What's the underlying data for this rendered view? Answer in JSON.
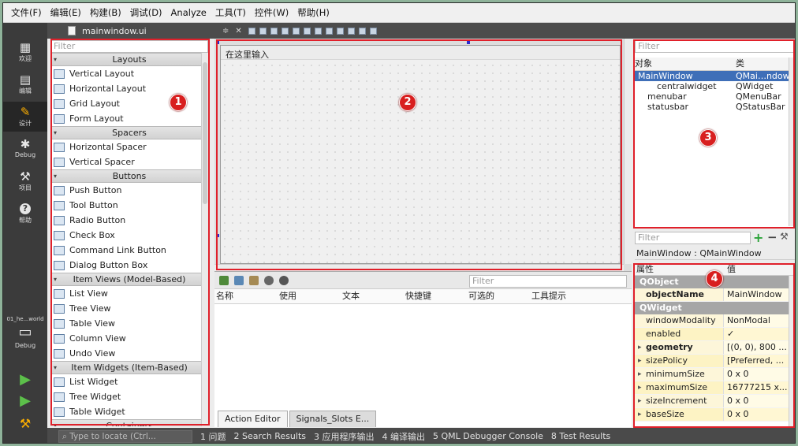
{
  "menubar": [
    "文件(F)",
    "编辑(E)",
    "构建(B)",
    "调试(D)",
    "Analyze",
    "工具(T)",
    "控件(W)",
    "帮助(H)"
  ],
  "modes": [
    {
      "label": "欢迎",
      "icon": "grid-icon"
    },
    {
      "label": "编辑",
      "icon": "document-icon"
    },
    {
      "label": "设计",
      "icon": "pen-icon",
      "active": true
    },
    {
      "label": "Debug",
      "icon": "bug-icon"
    },
    {
      "label": "项目",
      "icon": "wrench-icon"
    },
    {
      "label": "帮助",
      "icon": "help-icon"
    }
  ],
  "kit": {
    "project": "01_he...world",
    "config": "Debug"
  },
  "file_tab": "mainwindow.ui",
  "widget_box": {
    "filter_placeholder": "Filter",
    "categories": [
      {
        "title": "Layouts",
        "items": [
          "Vertical Layout",
          "Horizontal Layout",
          "Grid Layout",
          "Form Layout"
        ]
      },
      {
        "title": "Spacers",
        "items": [
          "Horizontal Spacer",
          "Vertical Spacer"
        ]
      },
      {
        "title": "Buttons",
        "items": [
          "Push Button",
          "Tool Button",
          "Radio Button",
          "Check Box",
          "Command Link Button",
          "Dialog Button Box"
        ]
      },
      {
        "title": "Item Views (Model-Based)",
        "items": [
          "List View",
          "Tree View",
          "Table View",
          "Column View",
          "Undo View"
        ]
      },
      {
        "title": "Item Widgets (Item-Based)",
        "items": [
          "List Widget",
          "Tree Widget",
          "Table Widget"
        ]
      },
      {
        "title": "Containers",
        "items": []
      }
    ]
  },
  "form": {
    "menu_placeholder": "在这里输入"
  },
  "action_editor": {
    "filter_placeholder": "Filter",
    "columns": [
      "名称",
      "使用",
      "文本",
      "快捷键",
      "可选的",
      "工具提示"
    ],
    "tabs": [
      "Action Editor",
      "Signals_Slots E..."
    ]
  },
  "object_inspector": {
    "filter_placeholder": "Filter",
    "columns": [
      "对象",
      "类"
    ],
    "rows": [
      {
        "object": "MainWindow",
        "class": "QMai…ndow",
        "selected": true,
        "level": 0
      },
      {
        "object": "centralwidget",
        "class": "QWidget",
        "level": 2
      },
      {
        "object": "menubar",
        "class": "QMenuBar",
        "level": 1
      },
      {
        "object": "statusbar",
        "class": "QStatusBar",
        "level": 1
      }
    ]
  },
  "property_editor": {
    "filter_placeholder": "Filter",
    "class_label": "MainWindow : QMainWindow",
    "columns": [
      "属性",
      "值"
    ],
    "groups": [
      {
        "name": "QObject",
        "rows": [
          {
            "name": "objectName",
            "value": "MainWindow",
            "bold": true
          }
        ]
      },
      {
        "name": "QWidget",
        "rows": [
          {
            "name": "windowModality",
            "value": "NonModal"
          },
          {
            "name": "enabled",
            "value": "✓"
          },
          {
            "name": "geometry",
            "value": "[(0, 0), 800 ...",
            "bold": true,
            "expand": true
          },
          {
            "name": "sizePolicy",
            "value": "[Preferred, ...",
            "expand": true
          },
          {
            "name": "minimumSize",
            "value": "0 x 0",
            "expand": true
          },
          {
            "name": "maximumSize",
            "value": "16777215 x...",
            "expand": true
          },
          {
            "name": "sizeIncrement",
            "value": "0 x 0",
            "expand": true
          },
          {
            "name": "baseSize",
            "value": "0 x 0",
            "expand": true
          }
        ]
      }
    ]
  },
  "annotations": [
    "1",
    "2",
    "3",
    "4"
  ],
  "statusbar": {
    "locate_placeholder": "Type to locate (Ctrl...",
    "items": [
      "1 问题",
      "2 Search Results",
      "3 应用程序输出",
      "4 编译输出",
      "5 QML Debugger Console",
      "8 Test Results"
    ]
  }
}
